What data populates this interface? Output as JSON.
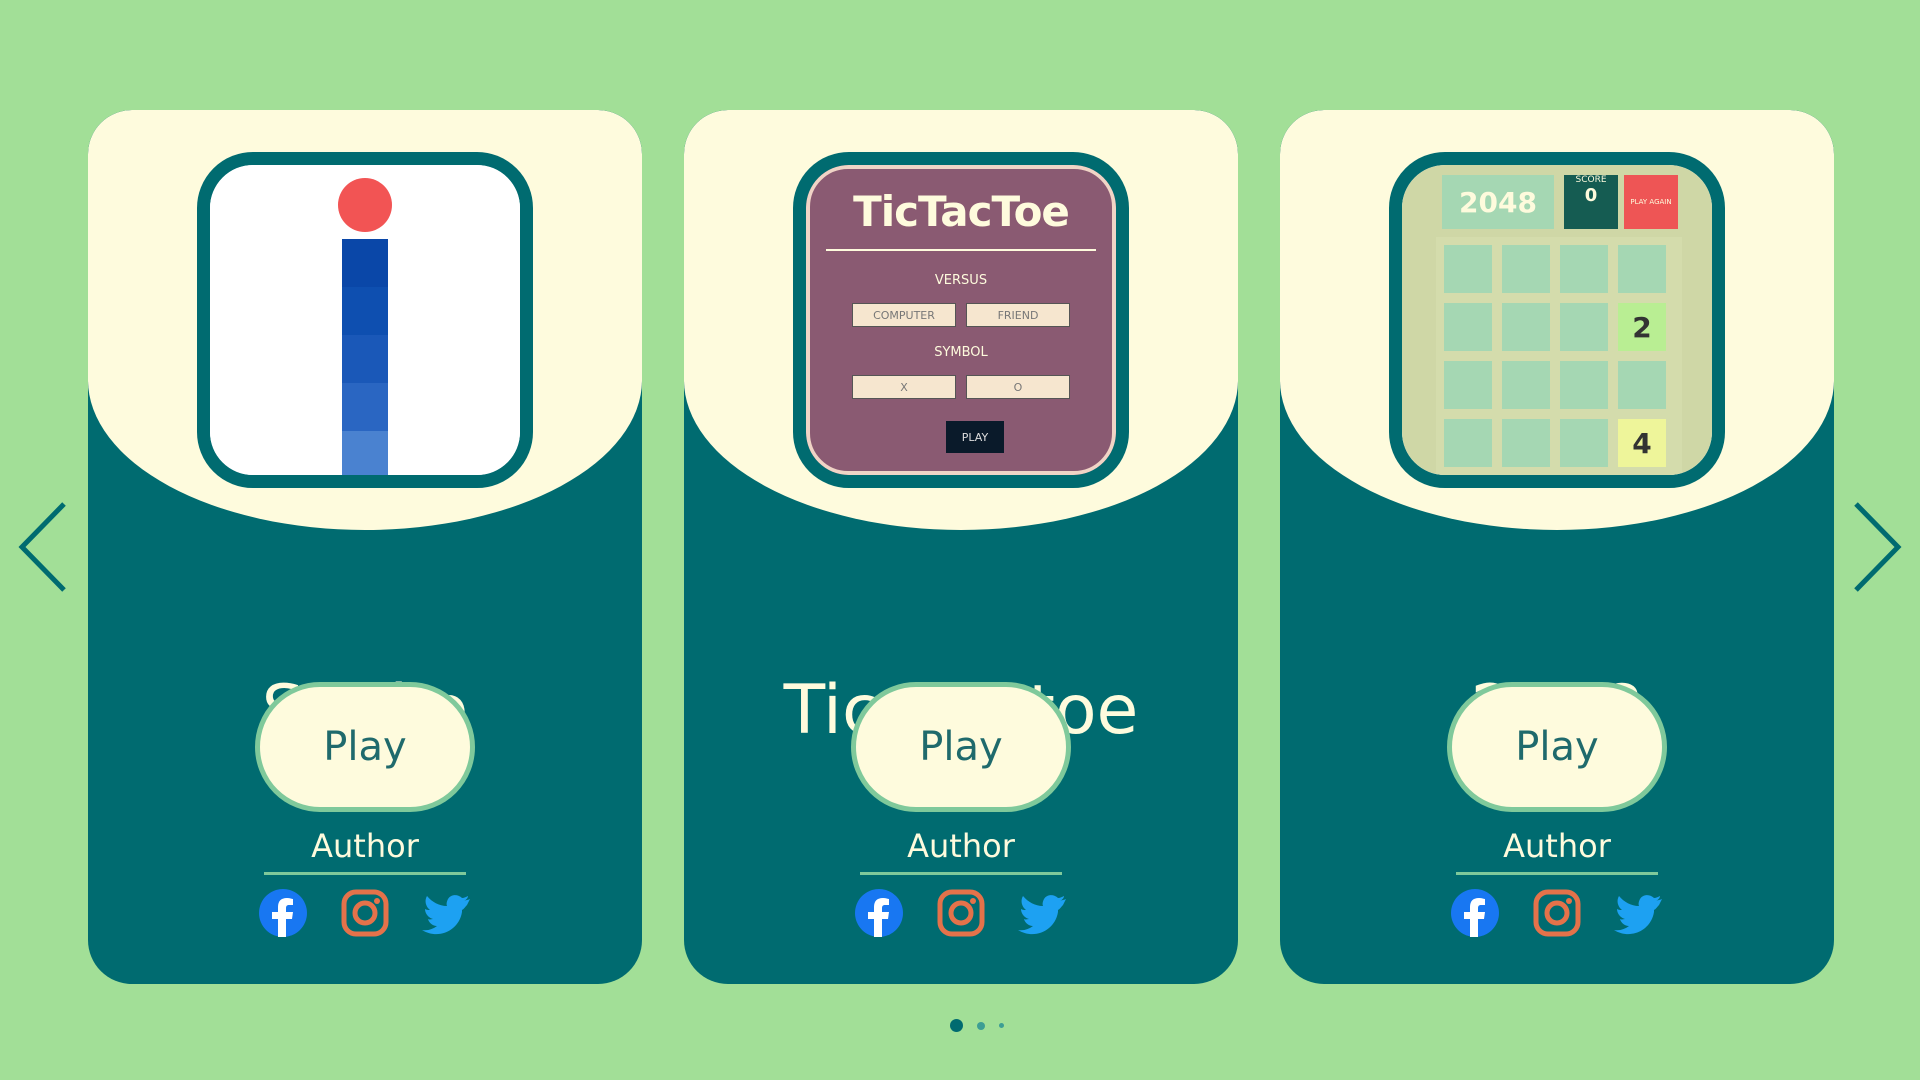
{
  "carousel": {
    "prev_label": "Previous",
    "next_label": "Next",
    "page_count": 3,
    "active_page": 0
  },
  "colors": {
    "background": "#a2df97",
    "card": "#006b70",
    "card_top": "#fefbdd",
    "accent": "#7fc99b",
    "facebook": "#1877f2",
    "instagram": "#e4724a",
    "twitter": "#1da1f2"
  },
  "cards": [
    {
      "title": "Snake",
      "play_label": "Play",
      "author_label": "Author",
      "socials": [
        "facebook-icon",
        "instagram-icon",
        "twitter-icon"
      ]
    },
    {
      "title": "Tic tac toe",
      "play_label": "Play",
      "author_label": "Author",
      "socials": [
        "facebook-icon",
        "instagram-icon",
        "twitter-icon"
      ],
      "preview": {
        "logo": "TicTacToe",
        "versus_label": "VERSUS",
        "versus_options": [
          "COMPUTER",
          "FRIEND"
        ],
        "symbol_label": "SYMBOL",
        "symbol_options": [
          "X",
          "O"
        ],
        "play_label": "PLAY"
      }
    },
    {
      "title": "2048",
      "play_label": "Play",
      "author_label": "Author",
      "socials": [
        "facebook-icon",
        "instagram-icon",
        "twitter-icon"
      ],
      "preview": {
        "logo": "2048",
        "score_label": "SCORE",
        "score_value": "0",
        "again_label": "PLAY AGAIN",
        "tiles": [
          "2",
          "4"
        ]
      }
    }
  ]
}
